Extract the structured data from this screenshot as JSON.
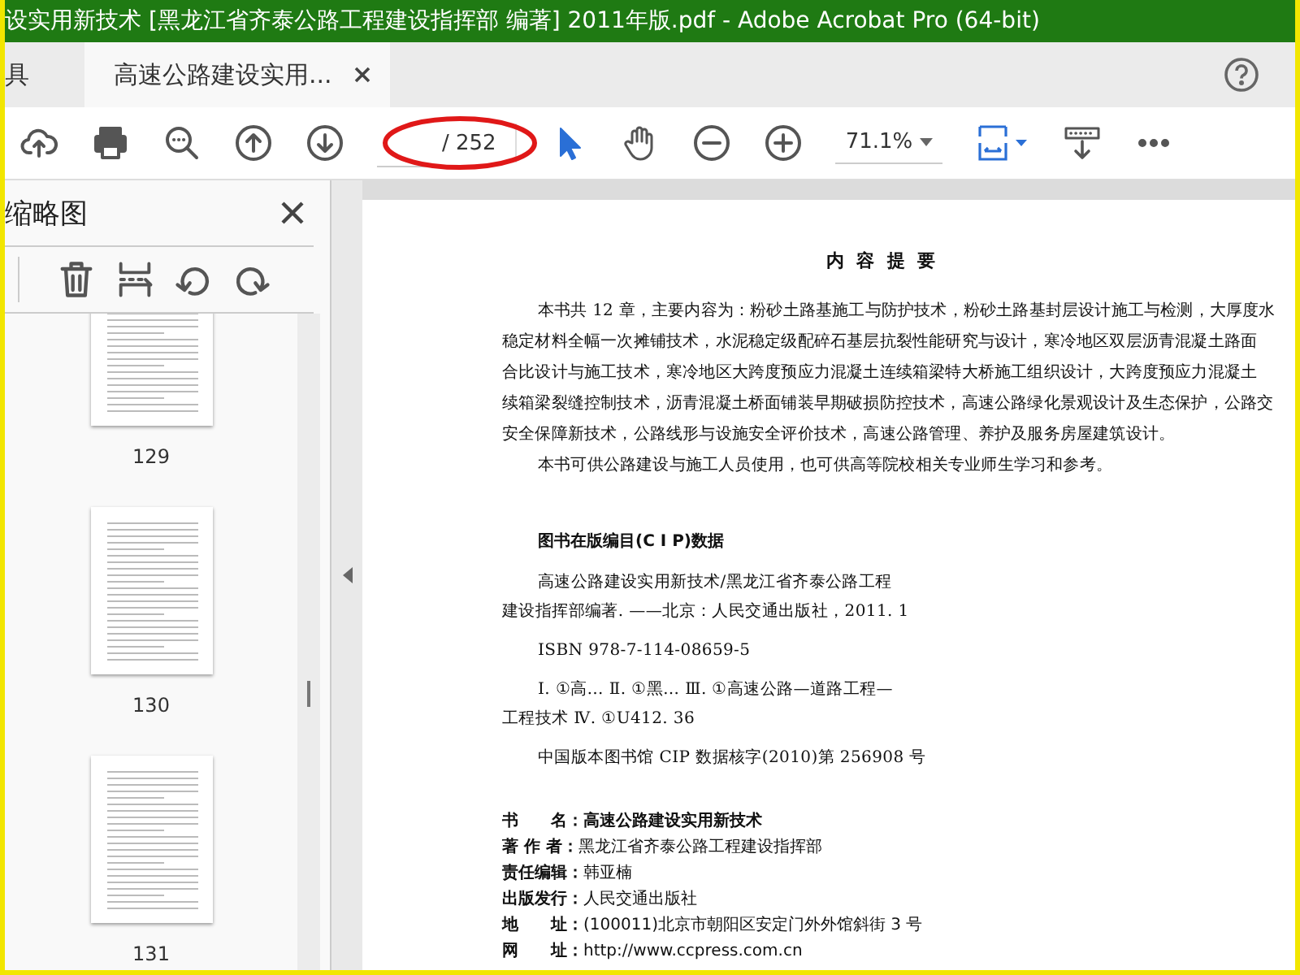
{
  "window": {
    "title": "设实用新技术 [黑龙江省齐泰公路工程建设指挥部 编著] 2011年版.pdf - Adobe Acrobat Pro (64-bit)"
  },
  "tabs": [
    {
      "label": "具",
      "selected": false
    },
    {
      "label": "高速公路建设实用...",
      "selected": true
    }
  ],
  "toolbar": {
    "page_total": "/ 252",
    "zoom": "71.1%"
  },
  "sidebar": {
    "title": "缩略图",
    "thumbnails": [
      {
        "page": "129"
      },
      {
        "page": "130"
      },
      {
        "page": "131"
      }
    ]
  },
  "document": {
    "heading": "内 容 提 要",
    "summary": [
      {
        "lines": [
          "本书共 12 章，主要内容为：粉砂土路基施工与防护技术，粉砂土路基封层设计施工与检测，大厚度水",
          "稳定材料全幅一次摊铺技术，水泥稳定级配碎石基层抗裂性能研究与设计，寒冷地区双层沥青混凝土路面",
          "合比设计与施工技术，寒冷地区大跨度预应力混凝土连续箱梁特大桥施工组织设计，大跨度预应力混凝土",
          "续箱梁裂缝控制技术，沥青混凝土桥面铺装早期破损防控技术，高速公路绿化景观设计及生态保护，公路交",
          "安全保障新技术，公路线形与设施安全评价技术，高速公路管理、养护及服务房屋建筑设计。"
        ]
      },
      {
        "lines": [
          "本书可供公路建设与施工人员使用，也可供高等院校相关专业师生学习和参考。"
        ]
      }
    ],
    "cip_heading": "图书在版编目(C I P)数据",
    "cip": [
      {
        "lines": [
          "高速公路建设实用新技术/黑龙江省齐泰公路工程",
          "建设指挥部编著. ——北京：人民交通出版社，2011. 1"
        ]
      },
      {
        "lines": [
          "ISBN  978-7-114-08659-5"
        ]
      },
      {
        "lines": [
          "Ⅰ. ①高… Ⅱ. ①黑… Ⅲ. ①高速公路—道路工程—",
          "工程技术   Ⅳ. ①U412. 36"
        ]
      },
      {
        "lines": [
          "中国版本图书馆 CIP 数据核字(2010)第 256908 号"
        ]
      }
    ],
    "colophon": [
      {
        "label": "书　　名：",
        "value": "高速公路建设实用新技术",
        "emphasis": true
      },
      {
        "label": "著 作 者：",
        "value": "黑龙江省齐泰公路工程建设指挥部",
        "emphasis": false
      },
      {
        "label": "责任编辑：",
        "value": "韩亚楠",
        "emphasis": false
      },
      {
        "label": "出版发行：",
        "value": "人民交通出版社",
        "emphasis": false
      },
      {
        "label": "地　　址：",
        "value": "(100011)北京市朝阳区安定门外外馆斜街 3 号",
        "emphasis": false
      },
      {
        "label": "网　　址：",
        "value": "http://www.ccpress.com.cn",
        "emphasis": false
      }
    ]
  }
}
